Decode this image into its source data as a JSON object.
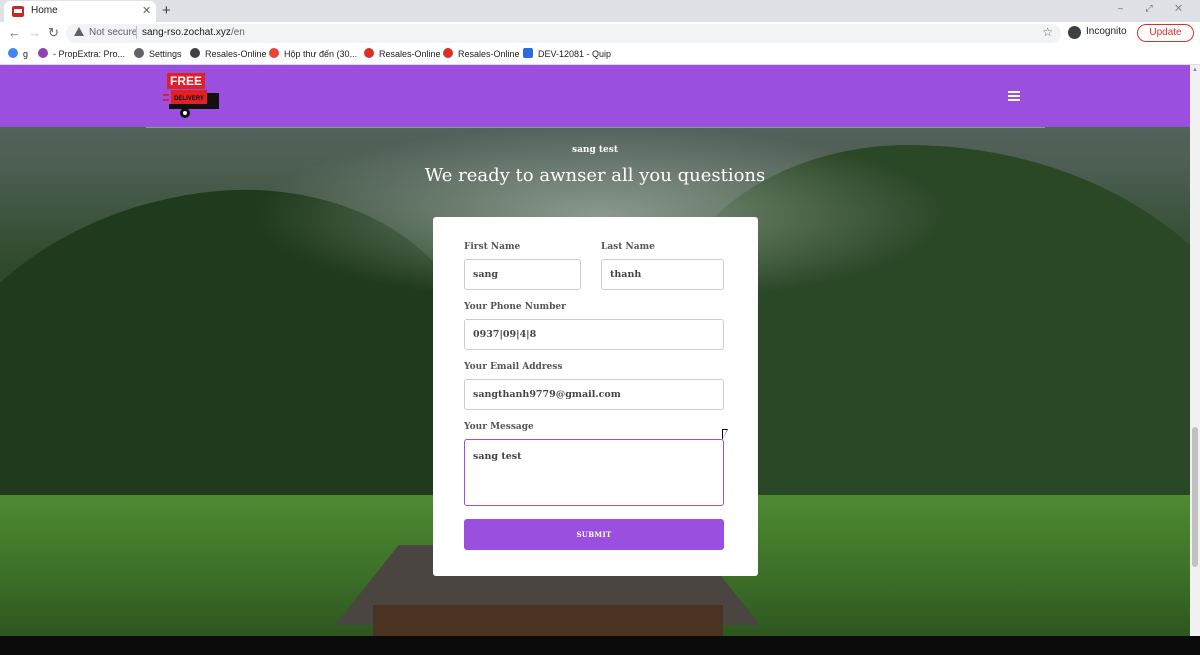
{
  "browser": {
    "tab_title": "Home",
    "tab_close": "✕",
    "new_tab": "+",
    "window_controls": "– ⤢ ✕",
    "security_label": "Not secure",
    "url_host": "sang-rso.zochat.xyz",
    "url_path": "/en",
    "profile_label": "Incognito",
    "update_label": "Update",
    "bookmarks": [
      {
        "label": "g",
        "icon": "google-icon",
        "color": "#4285f4"
      },
      {
        "label": "- PropExtra: Pro...",
        "icon": "propextra-icon",
        "color": "#8e44ad"
      },
      {
        "label": "Settings",
        "icon": "gear-icon",
        "color": "#5f6368"
      },
      {
        "label": "Resales-Online",
        "icon": "globe-icon",
        "color": "#3c4043"
      },
      {
        "label": "Hộp thư đến (30...",
        "icon": "gmail-icon",
        "color": "#ea4335"
      },
      {
        "label": "Resales-Online",
        "icon": "resales-icon",
        "color": "#d93025"
      },
      {
        "label": "Resales-Online",
        "icon": "resales-icon",
        "color": "#d93025"
      },
      {
        "label": "DEV-12081 - Quip",
        "icon": "quip-icon",
        "color": "#2b6be0"
      }
    ]
  },
  "site": {
    "brand_color": "#9b4fde",
    "logo_text_top": "FREE",
    "logo_text_bottom": "DELIVERY",
    "menu_icon": "hamburger-icon",
    "hero_small": "sang test",
    "hero_title": "We ready to awnser all you questions"
  },
  "form": {
    "first_name_label": "First Name",
    "first_name_value": "sang",
    "last_name_label": "Last Name",
    "last_name_value": "thanh",
    "phone_label": "Your Phone Number",
    "phone_value": "0937|09|4|8",
    "email_label": "Your Email Address",
    "email_value": "sangthanh9779@gmail.com",
    "message_label": "Your Message",
    "message_value": "sang test",
    "submit_label": "SUBMIT"
  }
}
